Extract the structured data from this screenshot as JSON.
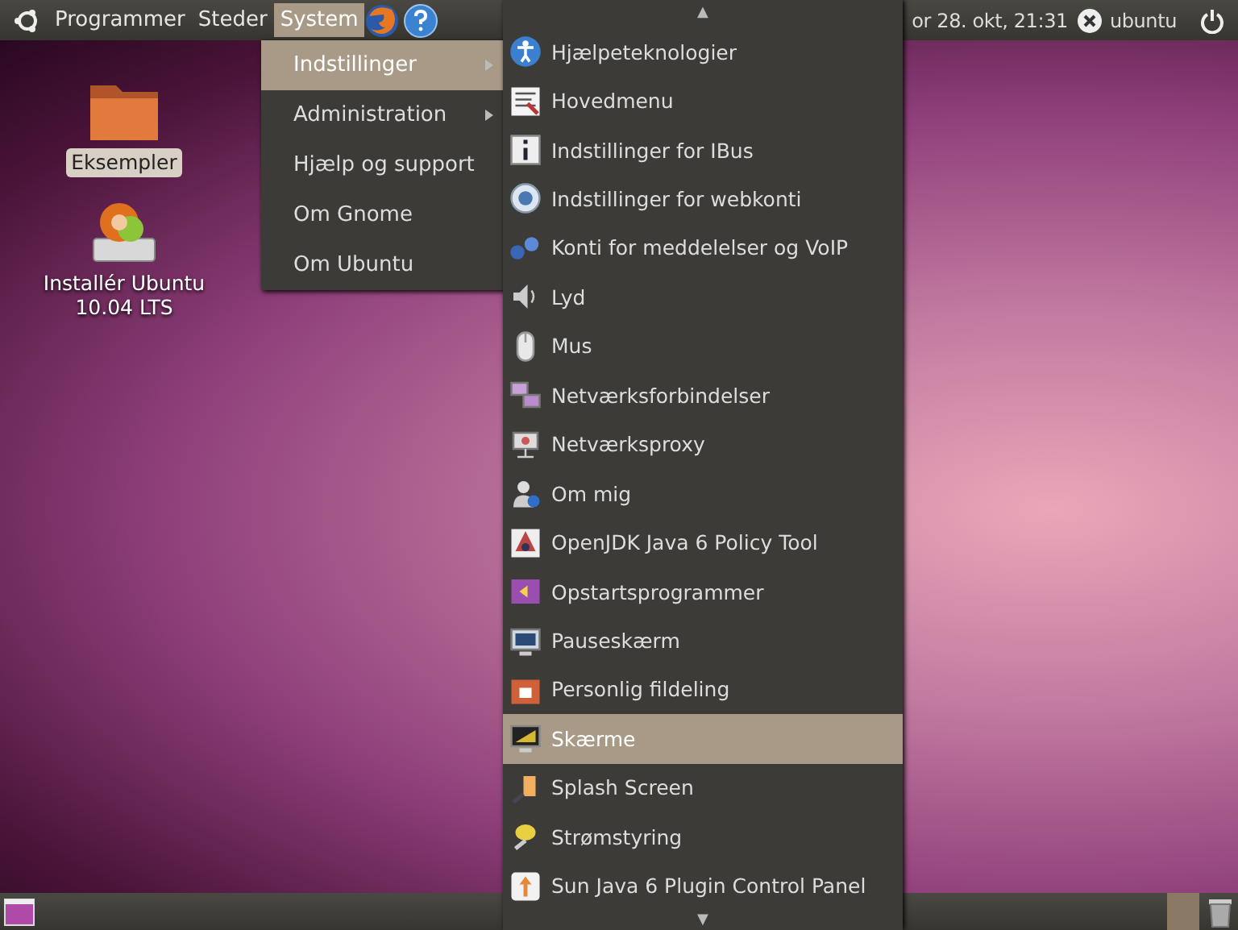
{
  "top_panel": {
    "menus": [
      {
        "label": "Programmer",
        "selected": false
      },
      {
        "label": "Steder",
        "selected": false
      },
      {
        "label": "System",
        "selected": true
      }
    ],
    "clock": "or 28. okt, 21:31",
    "user": "ubuntu"
  },
  "desktop_icons": [
    {
      "label": "Eksempler",
      "kind": "folder",
      "selected": true
    },
    {
      "label": "Installér Ubuntu 10.04 LTS",
      "kind": "installer",
      "selected": false
    }
  ],
  "system_menu": [
    {
      "label": "Indstillinger",
      "submenu": true,
      "selected": true
    },
    {
      "label": "Administration",
      "submenu": true,
      "selected": false
    },
    {
      "label": "Hjælp og support",
      "submenu": false,
      "selected": false
    },
    {
      "label": "Om Gnome",
      "submenu": false,
      "selected": false
    },
    {
      "label": "Om Ubuntu",
      "submenu": false,
      "selected": false
    }
  ],
  "settings_menu": {
    "scroll_up": "▲",
    "scroll_down": "▼",
    "items": [
      {
        "label": "Hjælpeteknologier",
        "selected": false
      },
      {
        "label": "Hovedmenu",
        "selected": false
      },
      {
        "label": "Indstillinger for IBus",
        "selected": false
      },
      {
        "label": "Indstillinger for webkonti",
        "selected": false
      },
      {
        "label": "Konti for meddelelser og VoIP",
        "selected": false
      },
      {
        "label": "Lyd",
        "selected": false
      },
      {
        "label": "Mus",
        "selected": false
      },
      {
        "label": "Netværksforbindelser",
        "selected": false
      },
      {
        "label": "Netværksproxy",
        "selected": false
      },
      {
        "label": "Om mig",
        "selected": false
      },
      {
        "label": "OpenJDK Java 6 Policy Tool",
        "selected": false
      },
      {
        "label": "Opstartsprogrammer",
        "selected": false
      },
      {
        "label": "Pauseskærm",
        "selected": false
      },
      {
        "label": "Personlig fildeling",
        "selected": false
      },
      {
        "label": "Skærme",
        "selected": true
      },
      {
        "label": "Splash Screen",
        "selected": false
      },
      {
        "label": "Strømstyring",
        "selected": false
      },
      {
        "label": "Sun Java 6 Plugin Control Panel",
        "selected": false
      }
    ]
  }
}
